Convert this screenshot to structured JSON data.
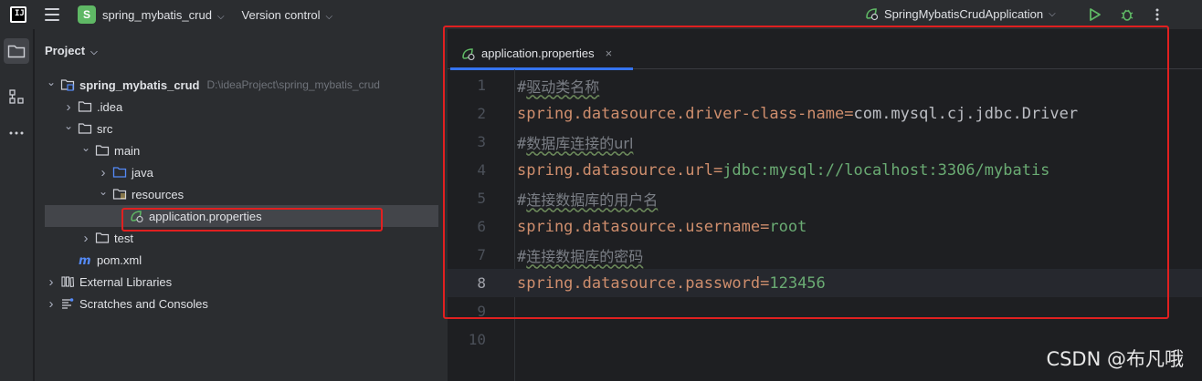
{
  "titlebar": {
    "logo_text": "IJ",
    "project_badge": "S",
    "project_name": "spring_mybatis_crud",
    "vcs_label": "Version control",
    "run_config": "SpringMybatisCrudApplication"
  },
  "panel": {
    "title": "Project"
  },
  "tree": [
    {
      "label": "spring_mybatis_crud",
      "hint": "D:\\ideaProject\\spring_mybatis_crud",
      "depth": 0,
      "arrow": "down",
      "icon": "module-folder-icon",
      "bold": true
    },
    {
      "label": ".idea",
      "depth": 1,
      "arrow": "right",
      "icon": "folder-icon"
    },
    {
      "label": "src",
      "depth": 1,
      "arrow": "down",
      "icon": "folder-icon"
    },
    {
      "label": "main",
      "depth": 2,
      "arrow": "down",
      "icon": "folder-icon"
    },
    {
      "label": "java",
      "depth": 3,
      "arrow": "right",
      "icon": "source-folder-icon"
    },
    {
      "label": "resources",
      "depth": 3,
      "arrow": "down",
      "icon": "resources-folder-icon"
    },
    {
      "label": "application.properties",
      "depth": 4,
      "arrow": "none",
      "icon": "spring-properties-icon",
      "selected": true
    },
    {
      "label": "test",
      "depth": 2,
      "arrow": "right",
      "icon": "folder-icon"
    },
    {
      "label": "pom.xml",
      "depth": 1,
      "arrow": "none",
      "icon": "maven-icon"
    },
    {
      "label": "External Libraries",
      "depth": 0,
      "arrow": "right",
      "icon": "libraries-icon"
    },
    {
      "label": "Scratches and Consoles",
      "depth": 0,
      "arrow": "right",
      "icon": "scratches-icon"
    }
  ],
  "editor": {
    "tab_label": "application.properties",
    "tab_close": "×",
    "current_line": 8,
    "lines": [
      {
        "n": "1",
        "type": "comment",
        "hash": "#",
        "text": "驱动类名称"
      },
      {
        "n": "2",
        "type": "prop",
        "key": "spring.datasource.driver-class-name",
        "value": "com.mysql.cj.jdbc.Driver"
      },
      {
        "n": "3",
        "type": "comment",
        "hash": "#",
        "text": "数据库连接的url"
      },
      {
        "n": "4",
        "type": "prop",
        "key": "spring.datasource.url",
        "value": "jdbc:mysql://localhost:3306/mybatis"
      },
      {
        "n": "5",
        "type": "comment",
        "hash": "#",
        "text": "连接数据库的用户名"
      },
      {
        "n": "6",
        "type": "prop",
        "key": "spring.datasource.username",
        "value": "root"
      },
      {
        "n": "7",
        "type": "comment",
        "hash": "#",
        "text": "连接数据库的密码"
      },
      {
        "n": "8",
        "type": "prop",
        "key": "spring.datasource.password",
        "value": "123456"
      },
      {
        "n": "9",
        "type": "empty"
      },
      {
        "n": "10",
        "type": "empty"
      }
    ]
  },
  "watermark": "CSDN @布凡哦",
  "colors": {
    "accent": "#3574f0",
    "highlight_box": "#e02020",
    "run_green": "#5fb865"
  }
}
